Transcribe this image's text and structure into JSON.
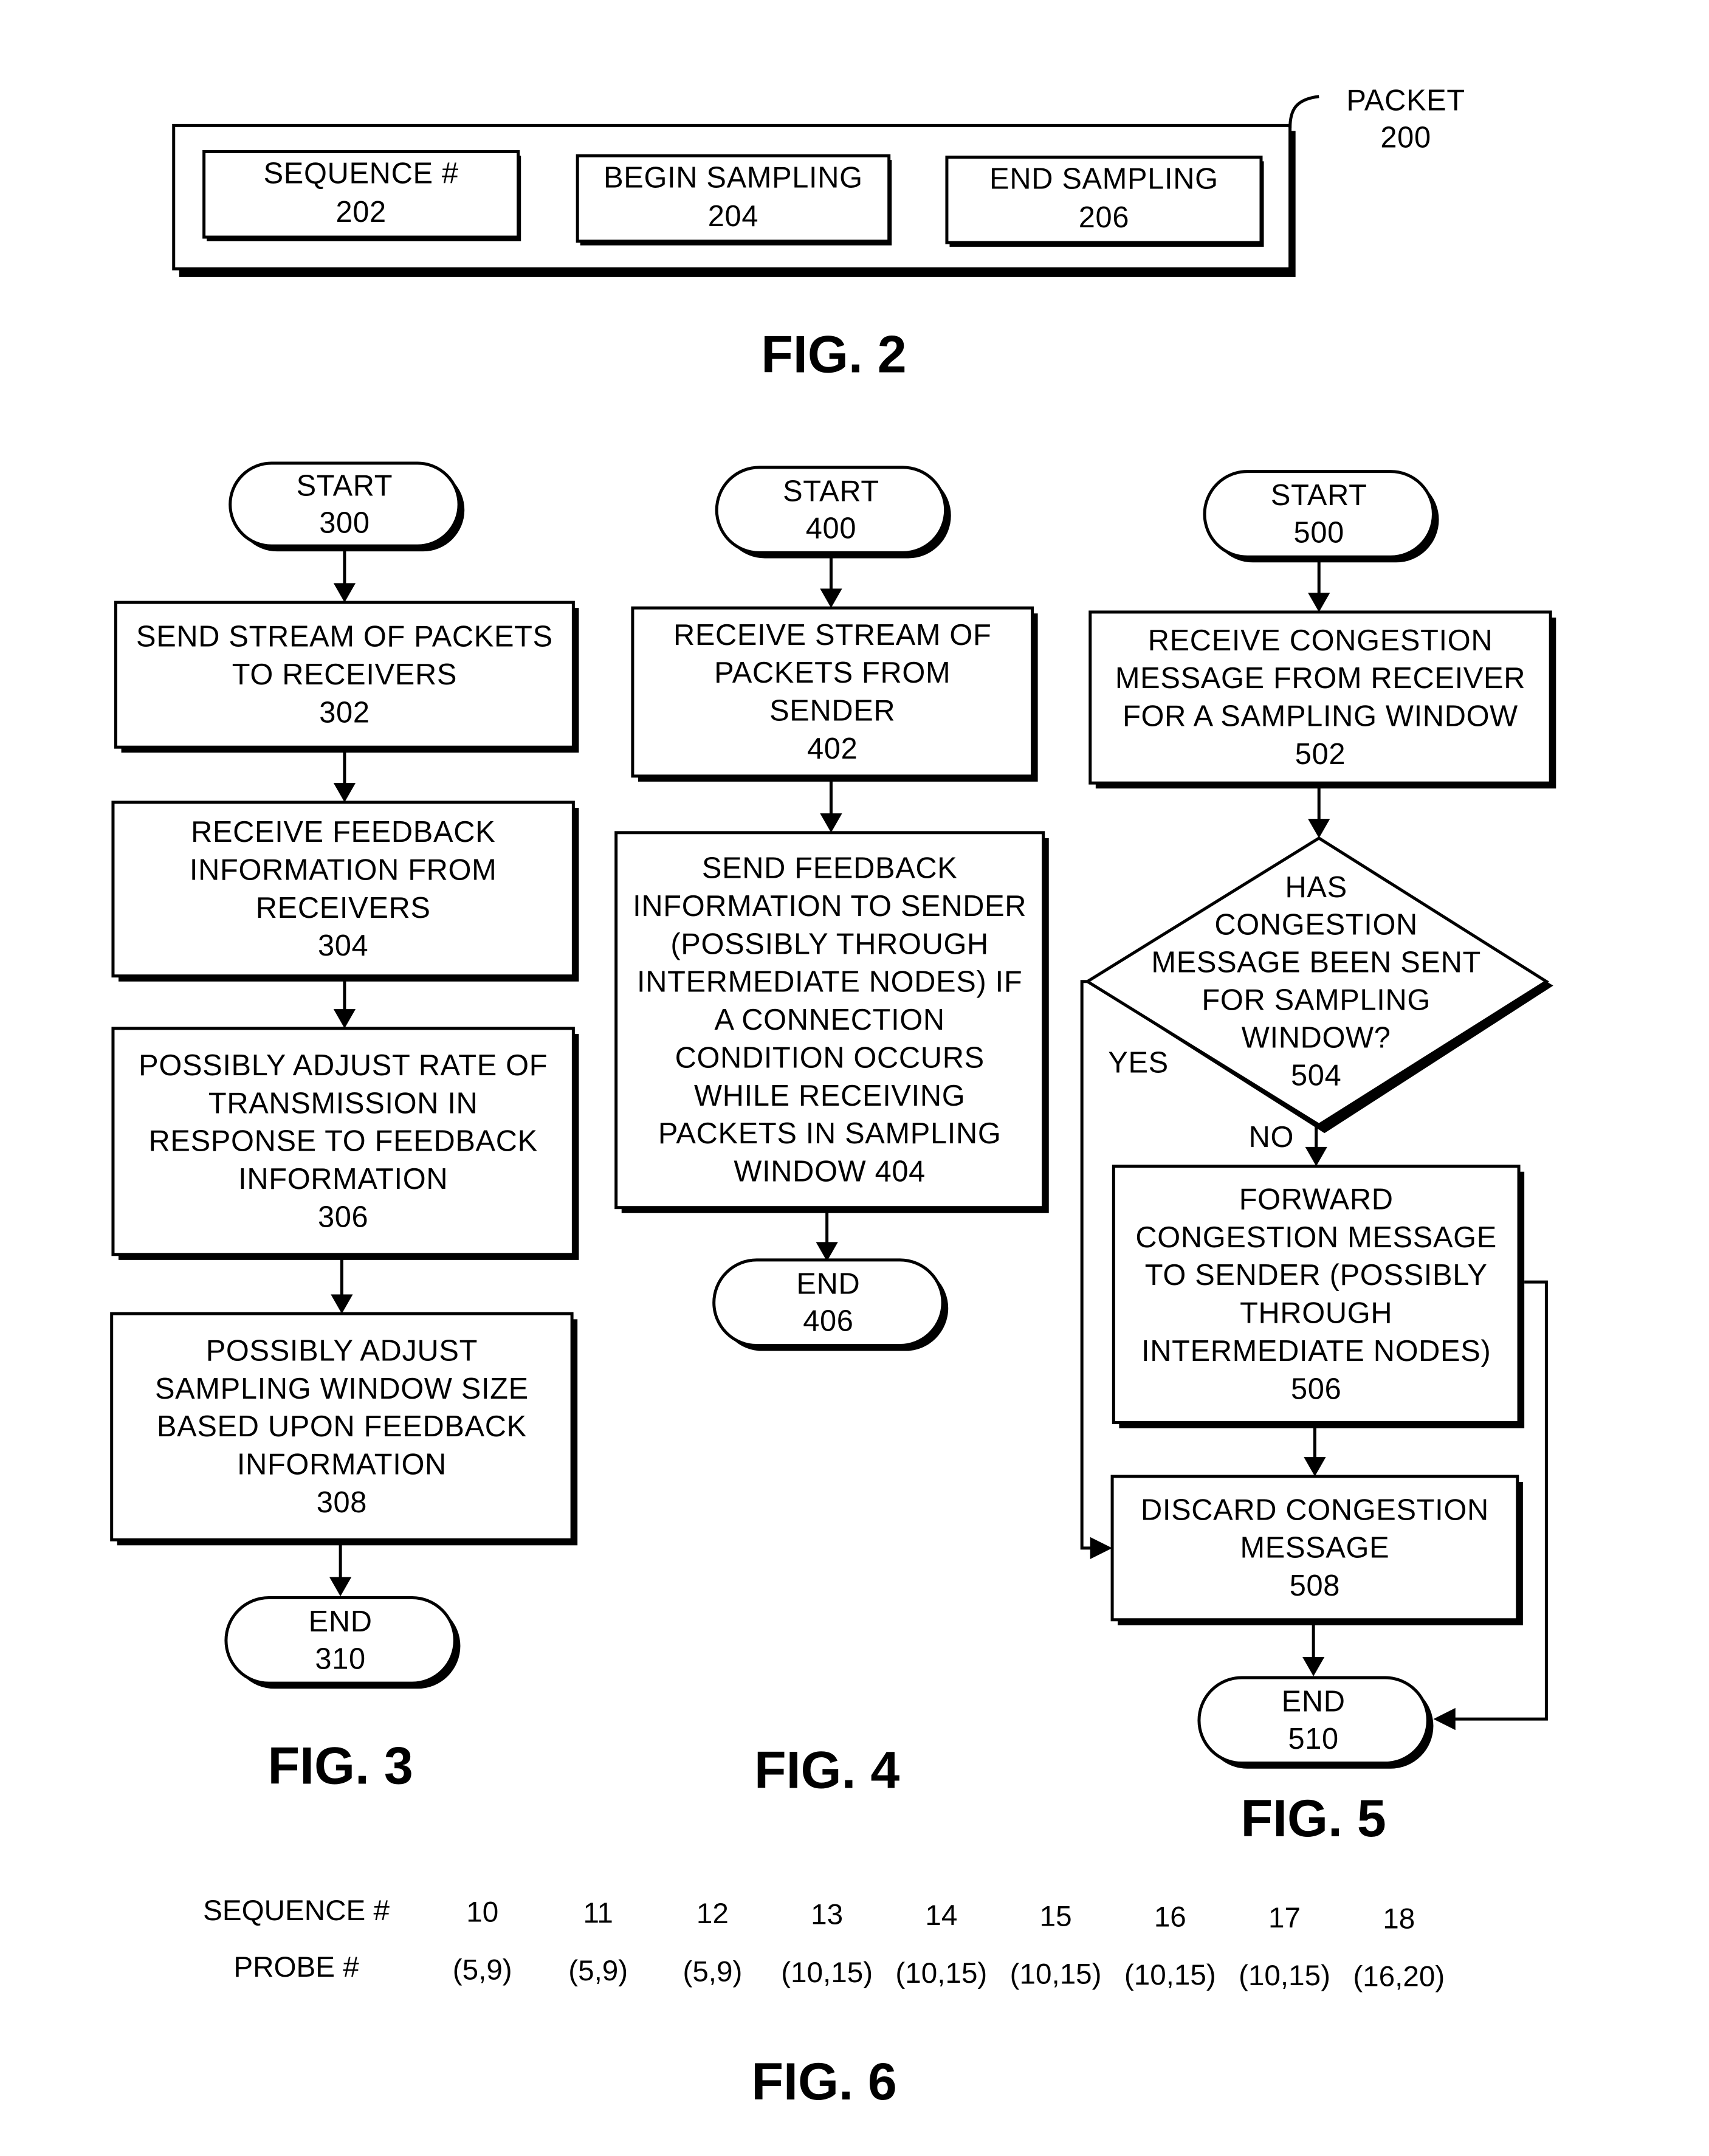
{
  "fig2": {
    "label": "FIG. 2",
    "packet_label": [
      "PACKET",
      "200"
    ],
    "fields": [
      {
        "lines": [
          "SEQUENCE #",
          "202"
        ]
      },
      {
        "lines": [
          "BEGIN SAMPLING",
          "204"
        ]
      },
      {
        "lines": [
          "END SAMPLING",
          "206"
        ]
      }
    ]
  },
  "fig3": {
    "label": "FIG. 3",
    "nodes": [
      {
        "id": "300",
        "type": "terminal",
        "lines": [
          "START",
          "300"
        ]
      },
      {
        "id": "302",
        "type": "process",
        "lines": [
          "SEND STREAM OF PACKETS",
          "TO RECEIVERS",
          "302"
        ]
      },
      {
        "id": "304",
        "type": "process",
        "lines": [
          "RECEIVE FEEDBACK",
          "INFORMATION FROM",
          "RECEIVERS",
          "304"
        ]
      },
      {
        "id": "306",
        "type": "process",
        "lines": [
          "POSSIBLY ADJUST RATE OF",
          "TRANSMISSION IN",
          "RESPONSE TO FEEDBACK",
          "INFORMATION",
          "306"
        ]
      },
      {
        "id": "308",
        "type": "process",
        "lines": [
          "POSSIBLY ADJUST",
          "SAMPLING WINDOW SIZE",
          "BASED UPON FEEDBACK",
          "INFORMATION",
          "308"
        ]
      },
      {
        "id": "310",
        "type": "terminal",
        "lines": [
          "END",
          "310"
        ]
      }
    ]
  },
  "fig4": {
    "label": "FIG. 4",
    "nodes": [
      {
        "id": "400",
        "type": "terminal",
        "lines": [
          "START",
          "400"
        ]
      },
      {
        "id": "402",
        "type": "process",
        "lines": [
          "RECEIVE STREAM OF",
          "PACKETS FROM",
          "SENDER",
          "402"
        ]
      },
      {
        "id": "404",
        "type": "process",
        "lines": [
          "SEND FEEDBACK",
          "INFORMATION TO SENDER",
          "(POSSIBLY THROUGH",
          "INTERMEDIATE NODES) IF",
          "A CONNECTION",
          "CONDITION OCCURS",
          "WHILE RECEIVING",
          "PACKETS IN SAMPLING",
          "WINDOW 404"
        ]
      },
      {
        "id": "406",
        "type": "terminal",
        "lines": [
          "END",
          "406"
        ]
      }
    ]
  },
  "fig5": {
    "label": "FIG. 5",
    "yes_label": "YES",
    "no_label": "NO",
    "nodes": [
      {
        "id": "500",
        "type": "terminal",
        "lines": [
          "START",
          "500"
        ]
      },
      {
        "id": "502",
        "type": "process",
        "lines": [
          "RECEIVE CONGESTION",
          "MESSAGE FROM RECEIVER",
          "FOR A SAMPLING WINDOW",
          "502"
        ]
      },
      {
        "id": "504",
        "type": "decision",
        "lines": [
          "HAS",
          "CONGESTION",
          "MESSAGE BEEN SENT",
          "FOR SAMPLING",
          "WINDOW?",
          "504"
        ]
      },
      {
        "id": "506",
        "type": "process",
        "lines": [
          "FORWARD",
          "CONGESTION MESSAGE",
          "TO SENDER (POSSIBLY",
          "THROUGH",
          "INTERMEDIATE NODES)",
          "506"
        ]
      },
      {
        "id": "508",
        "type": "process",
        "lines": [
          "DISCARD CONGESTION",
          "MESSAGE",
          "508"
        ]
      },
      {
        "id": "510",
        "type": "terminal",
        "lines": [
          "END",
          "510"
        ]
      }
    ]
  },
  "fig6": {
    "label": "FIG. 6",
    "row_headers": [
      "SEQUENCE #",
      "PROBE #"
    ],
    "columns": [
      {
        "sequence": "10",
        "probe": "(5,9)"
      },
      {
        "sequence": "11",
        "probe": "(5,9)"
      },
      {
        "sequence": "12",
        "probe": "(5,9)"
      },
      {
        "sequence": "13",
        "probe": "(10,15)"
      },
      {
        "sequence": "14",
        "probe": "(10,15)"
      },
      {
        "sequence": "15",
        "probe": "(10,15)"
      },
      {
        "sequence": "16",
        "probe": "(10,15)"
      },
      {
        "sequence": "17",
        "probe": "(10,15)"
      },
      {
        "sequence": "18",
        "probe": "(16,20)"
      }
    ]
  }
}
